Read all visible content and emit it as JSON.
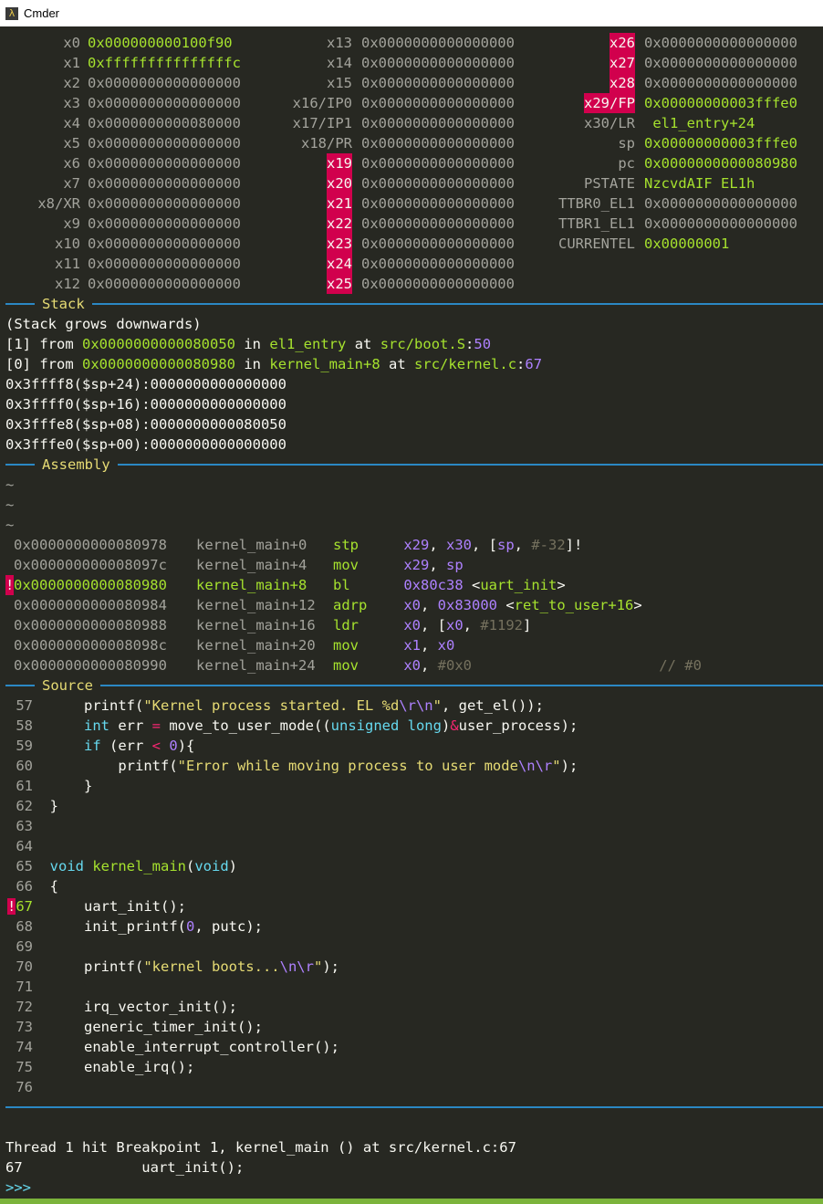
{
  "window": {
    "title": "Cmder"
  },
  "registers": {
    "col1": [
      {
        "name": "x0",
        "value": "0x000000000100f90",
        "changed": true
      },
      {
        "name": "x1",
        "value": "0xfffffffffffffffc",
        "changed": true
      },
      {
        "name": "x2",
        "value": "0x0000000000000000"
      },
      {
        "name": "x3",
        "value": "0x0000000000000000"
      },
      {
        "name": "x4",
        "value": "0x0000000000080000"
      },
      {
        "name": "x5",
        "value": "0x0000000000000000"
      },
      {
        "name": "x6",
        "value": "0x0000000000000000"
      },
      {
        "name": "x7",
        "value": "0x0000000000000000"
      },
      {
        "name": "x8/XR",
        "value": "0x0000000000000000"
      },
      {
        "name": "x9",
        "value": "0x0000000000000000"
      },
      {
        "name": "x10",
        "value": "0x0000000000000000"
      },
      {
        "name": "x11",
        "value": "0x0000000000000000"
      },
      {
        "name": "x12",
        "value": "0x0000000000000000"
      }
    ],
    "col2": [
      {
        "name": "x13",
        "value": "0x0000000000000000"
      },
      {
        "name": "x14",
        "value": "0x0000000000000000"
      },
      {
        "name": "x15",
        "value": "0x0000000000000000"
      },
      {
        "name": "x16/IP0",
        "value": "0x0000000000000000"
      },
      {
        "name": "x17/IP1",
        "value": "0x0000000000000000"
      },
      {
        "name": "x18/PR",
        "value": "0x0000000000000000"
      },
      {
        "name": "x19",
        "value": "0x0000000000000000",
        "hl": true
      },
      {
        "name": "x20",
        "value": "0x0000000000000000",
        "hl": true
      },
      {
        "name": "x21",
        "value": "0x0000000000000000",
        "hl": true
      },
      {
        "name": "x22",
        "value": "0x0000000000000000",
        "hl": true
      },
      {
        "name": "x23",
        "value": "0x0000000000000000",
        "hl": true
      },
      {
        "name": "x24",
        "value": "0x0000000000000000",
        "hl": true
      },
      {
        "name": "x25",
        "value": "0x0000000000000000",
        "hl": true
      }
    ],
    "col3": [
      {
        "name": "x26",
        "value": "0x0000000000000000",
        "hl": true
      },
      {
        "name": "x27",
        "value": "0x0000000000000000",
        "hl": true
      },
      {
        "name": "x28",
        "value": "0x0000000000000000",
        "hl": true
      },
      {
        "name": "x29/FP",
        "value": "0x00000000003fffe0",
        "hl": true,
        "changed": true
      },
      {
        "name": "x30/LR",
        "value": " el1_entry+24",
        "changed": true
      },
      {
        "name": "sp",
        "value": "0x00000000003fffe0",
        "changed": true
      },
      {
        "name": "pc",
        "value": "0x0000000000080980",
        "changed": true
      },
      {
        "name": "PSTATE",
        "value": "NzcvdAIF EL1h",
        "changed": true
      },
      {
        "name": "TTBR0_EL1",
        "value": "0x0000000000000000"
      },
      {
        "name": "TTBR1_EL1",
        "value": "0x0000000000000000"
      },
      {
        "name": "CURRENTEL",
        "value": "0x00000001",
        "changed": true
      }
    ]
  },
  "stack": {
    "title": "Stack",
    "grows": "(Stack grows downwards)",
    "frames": [
      {
        "idx": "[1]",
        "from": "from",
        "addr": "0x0000000000080050",
        "in": "in",
        "func": "el1_entry",
        "at": "at",
        "file": "src/boot.S",
        "line": "50"
      },
      {
        "idx": "[0]",
        "from": "from",
        "addr": "0x0000000000080980",
        "in": "in",
        "func": "kernel_main+8",
        "at": "at",
        "file": "src/kernel.c",
        "line": "67"
      }
    ],
    "memory": [
      "0x3ffff8($sp+24):0000000000000000",
      "0x3ffff0($sp+16):0000000000000000",
      "0x3fffe8($sp+08):0000000000080050",
      "0x3fffe0($sp+00):0000000000000000"
    ]
  },
  "assembly": {
    "title": "Assembly",
    "tildes": [
      "~",
      "~",
      "~"
    ],
    "rows": [
      {
        "marker": "",
        "addr": "0x0000000000080978",
        "sym": "kernel_main+0",
        "op": "stp",
        "args": [
          [
            "    x29",
            "p"
          ],
          [
            ", ",
            "w"
          ],
          [
            "x30",
            "p"
          ],
          [
            ", [",
            "w"
          ],
          [
            "sp",
            "p"
          ],
          [
            ", ",
            "w"
          ],
          [
            "#-32",
            "gr"
          ],
          [
            "]!",
            "w"
          ]
        ]
      },
      {
        "marker": "",
        "addr": "0x000000000008097c",
        "sym": "kernel_main+4",
        "op": "mov",
        "args": [
          [
            "    x29",
            "p"
          ],
          [
            ", ",
            "w"
          ],
          [
            "sp",
            "p"
          ]
        ]
      },
      {
        "marker": "!",
        "addr": "0x0000000000080980",
        "sym": "kernel_main+8",
        "op": "bl",
        "args": [
          [
            "    0x80c38",
            "p"
          ],
          [
            " <",
            "w"
          ],
          [
            "uart_init",
            "g"
          ],
          [
            ">",
            "w"
          ]
        ],
        "current": true
      },
      {
        "marker": "",
        "addr": "0x0000000000080984",
        "sym": "kernel_main+12",
        "op": "adrp",
        "args": [
          [
            "    x0",
            "p"
          ],
          [
            ", ",
            "w"
          ],
          [
            "0x83000",
            "p"
          ],
          [
            " <",
            "w"
          ],
          [
            "ret_to_user+16",
            "g"
          ],
          [
            ">",
            "w"
          ]
        ]
      },
      {
        "marker": "",
        "addr": "0x0000000000080988",
        "sym": "kernel_main+16",
        "op": "ldr",
        "args": [
          [
            "    x0",
            "p"
          ],
          [
            ", [",
            "w"
          ],
          [
            "x0",
            "p"
          ],
          [
            ", ",
            "w"
          ],
          [
            "#1192",
            "gr"
          ],
          [
            "]",
            "w"
          ]
        ]
      },
      {
        "marker": "",
        "addr": "0x000000000008098c",
        "sym": "kernel_main+20",
        "op": "mov",
        "args": [
          [
            "    x1",
            "p"
          ],
          [
            ", ",
            "w"
          ],
          [
            "x0",
            "p"
          ]
        ]
      },
      {
        "marker": "",
        "addr": "0x0000000000080990",
        "sym": "kernel_main+24",
        "op": "mov",
        "args": [
          [
            "    x0",
            "p"
          ],
          [
            ", ",
            "w"
          ],
          [
            "#0x0",
            "gr"
          ],
          [
            "                      // #0",
            "gr"
          ]
        ]
      }
    ]
  },
  "source": {
    "title": "Source",
    "rows": [
      {
        "n": "57",
        "code": [
          [
            "    printf(",
            "w"
          ],
          [
            "\"Kernel process started. EL %d",
            "y"
          ],
          [
            "\\r\\n",
            "p"
          ],
          [
            "\"",
            "y"
          ],
          [
            ", get_el());",
            "w"
          ]
        ]
      },
      {
        "n": "58",
        "code": [
          [
            "    ",
            "w"
          ],
          [
            "int",
            "c"
          ],
          [
            " err ",
            "w"
          ],
          [
            "=",
            "pk"
          ],
          [
            " move_to_user_mode((",
            "w"
          ],
          [
            "unsigned long",
            "c"
          ],
          [
            ")",
            "w"
          ],
          [
            "&",
            "pk"
          ],
          [
            "user_process);",
            "w"
          ]
        ]
      },
      {
        "n": "59",
        "code": [
          [
            "    ",
            "w"
          ],
          [
            "if",
            "c"
          ],
          [
            " (err ",
            "w"
          ],
          [
            "<",
            "pk"
          ],
          [
            " ",
            "w"
          ],
          [
            "0",
            "p"
          ],
          [
            "){",
            "w"
          ]
        ]
      },
      {
        "n": "60",
        "code": [
          [
            "        printf(",
            "w"
          ],
          [
            "\"Error while moving process to user mode",
            "y"
          ],
          [
            "\\n\\r",
            "p"
          ],
          [
            "\"",
            "y"
          ],
          [
            ");",
            "w"
          ]
        ]
      },
      {
        "n": "61",
        "code": [
          [
            "    }",
            "w"
          ]
        ]
      },
      {
        "n": "62",
        "code": [
          [
            "}",
            "w"
          ]
        ]
      },
      {
        "n": "63",
        "code": []
      },
      {
        "n": "64",
        "code": []
      },
      {
        "n": "65",
        "code": [
          [
            "void",
            "c"
          ],
          [
            " ",
            "w"
          ],
          [
            "kernel_main",
            "g"
          ],
          [
            "(",
            "w"
          ],
          [
            "void",
            "c"
          ],
          [
            ")",
            "w"
          ]
        ]
      },
      {
        "n": "66",
        "code": [
          [
            "{",
            "w"
          ]
        ]
      },
      {
        "n": "67",
        "code": [
          [
            "    uart_init();",
            "w"
          ]
        ],
        "bp": true
      },
      {
        "n": "68",
        "code": [
          [
            "    init_printf(",
            "w"
          ],
          [
            "0",
            "p"
          ],
          [
            ", putc);",
            "w"
          ]
        ]
      },
      {
        "n": "69",
        "code": []
      },
      {
        "n": "70",
        "code": [
          [
            "    printf(",
            "w"
          ],
          [
            "\"kernel boots...",
            "y"
          ],
          [
            "\\n\\r",
            "p"
          ],
          [
            "\"",
            "y"
          ],
          [
            ");",
            "w"
          ]
        ]
      },
      {
        "n": "71",
        "code": []
      },
      {
        "n": "72",
        "code": [
          [
            "    irq_vector_init();",
            "w"
          ]
        ]
      },
      {
        "n": "73",
        "code": [
          [
            "    generic_timer_init();",
            "w"
          ]
        ]
      },
      {
        "n": "74",
        "code": [
          [
            "    enable_interrupt_controller();",
            "w"
          ]
        ]
      },
      {
        "n": "75",
        "code": [
          [
            "    enable_irq();",
            "w"
          ]
        ]
      },
      {
        "n": "76",
        "code": []
      }
    ]
  },
  "console": {
    "lines": [
      "Thread 1 hit Breakpoint 1, kernel_main () at src/kernel.c:67",
      "67              uart_init();"
    ],
    "prompt": ">>>"
  },
  "colors": {
    "background": "#272822",
    "separator": "#2b88c4",
    "highlight": "#d1004d",
    "changed": "#a6e22e",
    "title_yellow": "#e6db74"
  }
}
